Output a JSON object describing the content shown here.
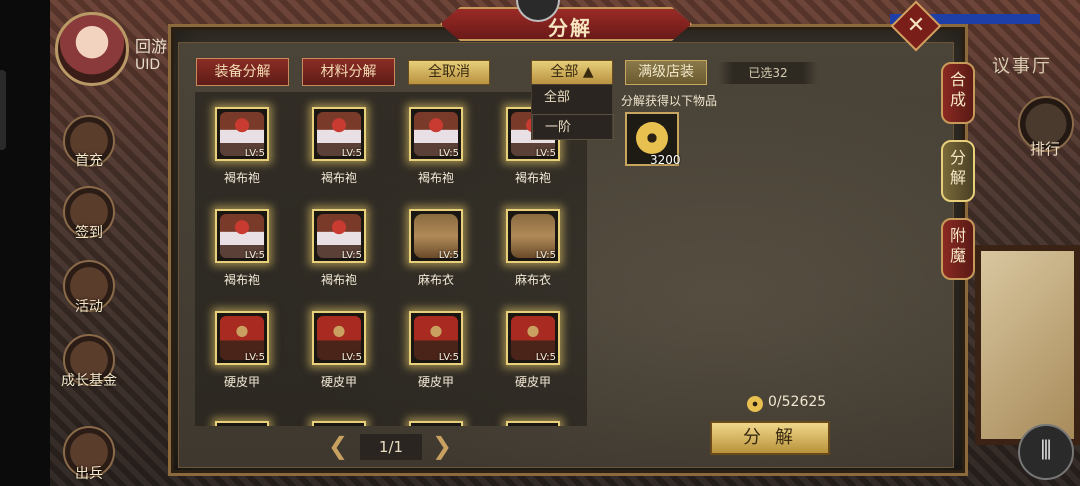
{
  "header": {
    "title": "分解"
  },
  "player": {
    "name": "回游",
    "uid_label": "UID"
  },
  "left_menu": [
    {
      "label": "首充",
      "icon": "gift-icon"
    },
    {
      "label": "签到",
      "icon": "calendar-icon"
    },
    {
      "label": "活动",
      "icon": "event-icon"
    },
    {
      "label": "成长基金",
      "icon": "fund-icon"
    },
    {
      "label": "出兵",
      "icon": "troops-icon"
    }
  ],
  "right_hud": {
    "hall_label": "议事厅",
    "rank_label": "排行",
    "menu_icon": "menu-icon"
  },
  "top_buttons": {
    "equip": "装备分解",
    "material": "材料分解",
    "deselect_all": "全取消",
    "filter_value": "全部 ▲",
    "max_store": "满级店装",
    "selected_count": "已选32"
  },
  "filter_dropdown": {
    "options": [
      "全部",
      "一阶"
    ]
  },
  "items": [
    {
      "name": "褐布袍",
      "level": "LV:5",
      "art": "robe"
    },
    {
      "name": "褐布袍",
      "level": "LV:5",
      "art": "robe"
    },
    {
      "name": "褐布袍",
      "level": "LV:5",
      "art": "robe"
    },
    {
      "name": "褐布袍",
      "level": "LV:5",
      "art": "robe"
    },
    {
      "name": "褐布袍",
      "level": "LV:5",
      "art": "robe"
    },
    {
      "name": "褐布袍",
      "level": "LV:5",
      "art": "robe"
    },
    {
      "name": "麻布衣",
      "level": "LV:5",
      "art": "cloth"
    },
    {
      "name": "麻布衣",
      "level": "LV:5",
      "art": "cloth"
    },
    {
      "name": "硬皮甲",
      "level": "LV:5",
      "art": "armor"
    },
    {
      "name": "硬皮甲",
      "level": "LV:5",
      "art": "armor"
    },
    {
      "name": "硬皮甲",
      "level": "LV:5",
      "art": "armor"
    },
    {
      "name": "硬皮甲",
      "level": "LV:5",
      "art": "armor"
    }
  ],
  "pagination": {
    "text": "1/1"
  },
  "reward": {
    "title": "分解获得以下物品",
    "count": "3200",
    "icon": "coin-icon"
  },
  "total": {
    "text": "0/52625"
  },
  "decompose_button": "分解",
  "side_tabs": [
    {
      "label": "合成",
      "active": false
    },
    {
      "label": "分解",
      "active": true
    },
    {
      "label": "附魔",
      "active": false
    }
  ],
  "colors": {
    "accent_gold": "#e8d07a",
    "banner_red": "#9a2a26",
    "panel_dark": "#2a2620"
  }
}
